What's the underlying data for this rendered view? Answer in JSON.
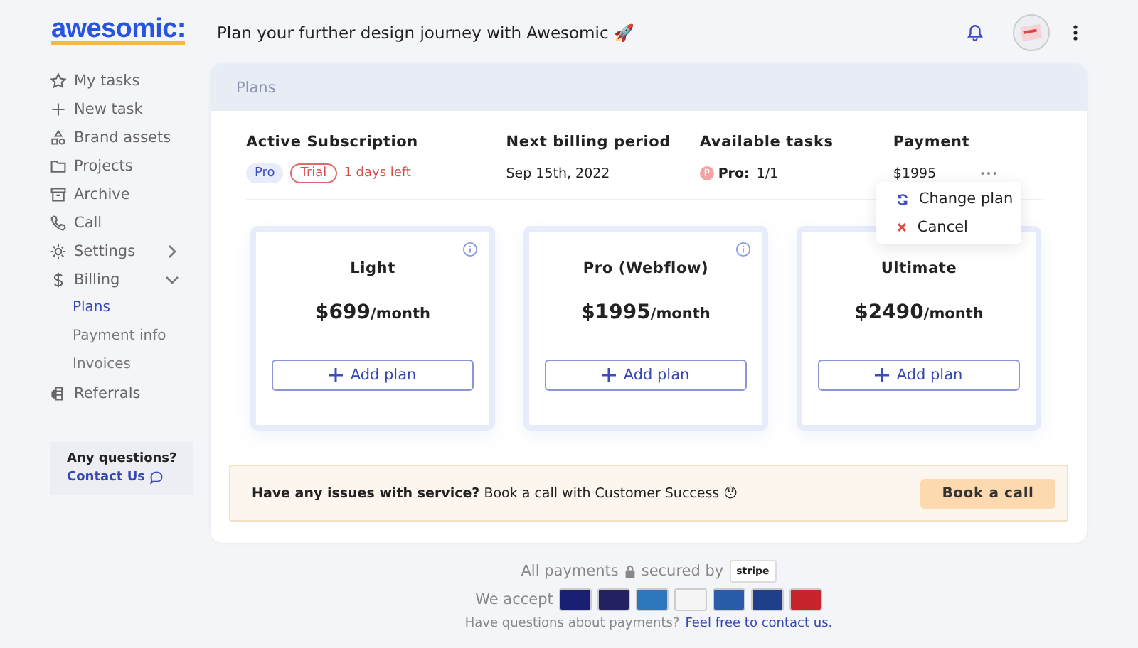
{
  "header": {
    "logo": "awesomic:",
    "tagline": "Plan your further design journey with Awesomic 🚀"
  },
  "sidebar": {
    "items": [
      {
        "label": "My tasks",
        "selected": false
      },
      {
        "label": "New task",
        "selected": false
      },
      {
        "label": "Brand assets",
        "selected": false
      },
      {
        "label": "Projects",
        "selected": false
      },
      {
        "label": "Archive",
        "selected": false
      },
      {
        "label": "Call",
        "selected": false
      },
      {
        "label": "Settings",
        "selected": false,
        "expanded": false
      },
      {
        "label": "Billing",
        "selected": false,
        "expanded": true,
        "children": [
          {
            "label": "Plans",
            "selected": true
          },
          {
            "label": "Payment info",
            "selected": false
          },
          {
            "label": "Invoices",
            "selected": false
          }
        ]
      },
      {
        "label": "Referrals",
        "selected": false
      }
    ],
    "help": {
      "question": "Any questions?",
      "link": "Contact Us"
    }
  },
  "panel": {
    "title": "Plans",
    "subscription": {
      "columns": [
        "Active Subscription",
        "Next billing period",
        "Available tasks",
        "Payment"
      ],
      "plan_badge": "Pro",
      "trial_badge": "Trial",
      "trial_left": "1 days left",
      "next_billing": "Sep 15th, 2022",
      "tasks_mark": "P",
      "tasks_label": "Pro:",
      "tasks_value": "1/1",
      "payment": "$1995"
    },
    "menu": [
      {
        "label": "Change plan",
        "kind": "change"
      },
      {
        "label": "Cancel",
        "kind": "cancel"
      }
    ],
    "plans": [
      {
        "title": "Light",
        "price": "$699",
        "period": "/month",
        "button": "Add plan",
        "info": true
      },
      {
        "title": "Pro (Webflow)",
        "price": "$1995",
        "period": "/month",
        "button": "Add plan",
        "info": true
      },
      {
        "title": "Ultimate",
        "price": "$2490",
        "period": "/month",
        "button": "Add plan",
        "info": false
      }
    ],
    "banner": {
      "text": "**Have any issues with service?** Book a call with Customer Success 😯",
      "button": "Book a call"
    }
  },
  "footer": {
    "secured_before": "All payments",
    "secured_after": "secured by",
    "stripe": "stripe",
    "accept": "We accept",
    "cards": [
      {
        "color": "#1a1f71"
      },
      {
        "color": "#23215f"
      },
      {
        "color": "#2e77bc"
      },
      {
        "color": "#f5f5f5"
      },
      {
        "color": "#2a5caa"
      },
      {
        "color": "#1f3f8a"
      },
      {
        "color": "#c8242b"
      }
    ],
    "question": "Have questions about payments?",
    "link": "Feel free to contact us."
  }
}
